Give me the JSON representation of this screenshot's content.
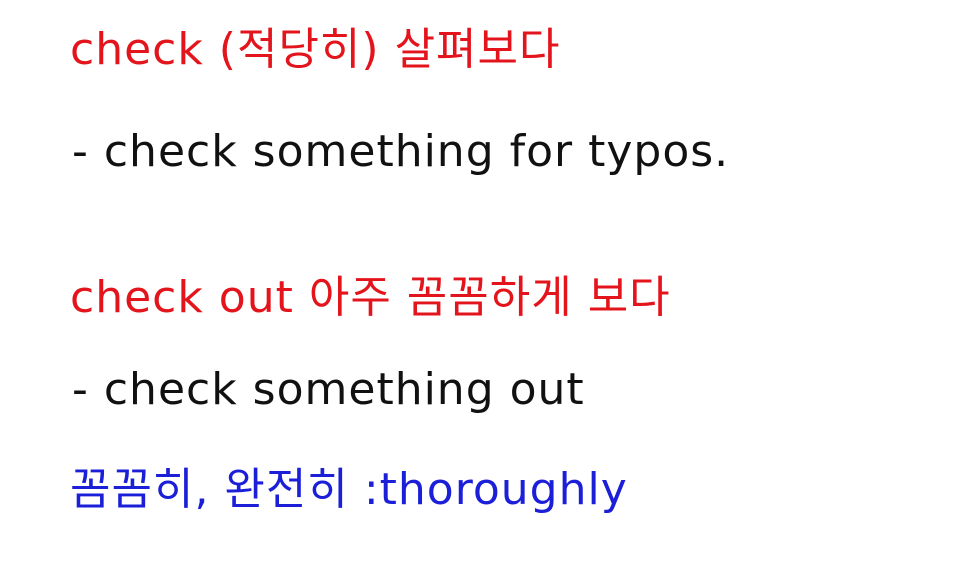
{
  "notes": [
    {
      "text": "check (적당히) 살펴보다",
      "color": "#e3141c"
    },
    {
      "text": "- check something for typos.",
      "color": "#111111"
    },
    {
      "text": "check out 아주 꼼꼼하게 보다",
      "color": "#e3141c"
    },
    {
      "text": "- check something out",
      "color": "#111111"
    },
    {
      "text": "꼼꼼히, 완전히 :thoroughly",
      "color": "#1b1fd8"
    }
  ]
}
